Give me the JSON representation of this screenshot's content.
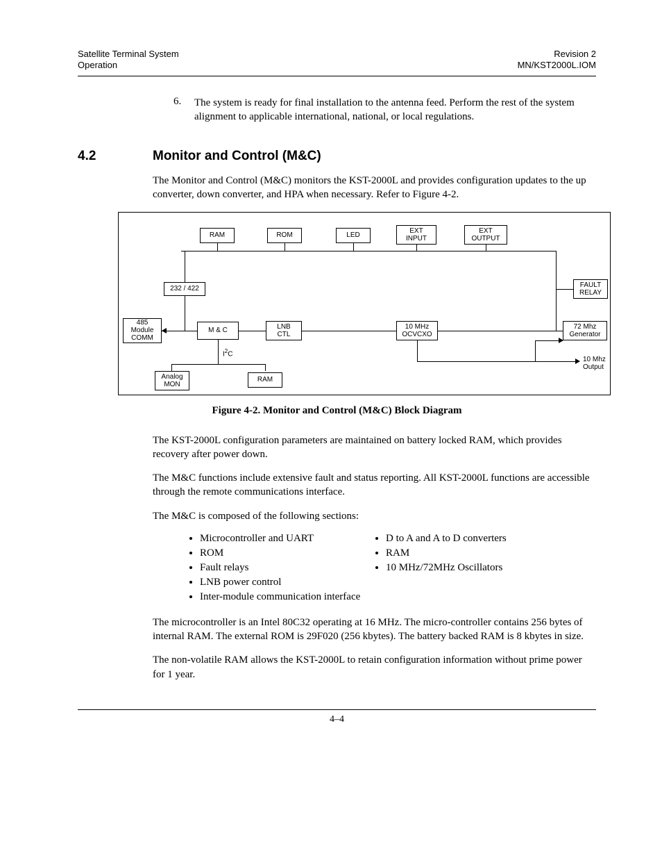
{
  "header": {
    "left1": "Satellite Terminal System",
    "left2": "Operation",
    "right1": "Revision 2",
    "right2": "MN/KST2000L.IOM"
  },
  "item6": {
    "num": "6.",
    "text": "The system is ready for final installation to the antenna feed. Perform the rest of the system alignment to applicable international, national, or local regulations."
  },
  "section": {
    "num": "4.2",
    "title": "Monitor and Control (M&C)"
  },
  "p1": "The Monitor and Control (M&C) monitors the KST-2000L and provides configuration updates to the up converter, down converter, and HPA when necessary. Refer to Figure 4-2.",
  "diagram": {
    "ram": "RAM",
    "rom": "ROM",
    "led": "LED",
    "ext_input": "EXT\nINPUT",
    "ext_output": "EXT\nOUTPUT",
    "rs232": "232 / 422",
    "fault_relay": "FAULT\nRELAY",
    "mod485": "485\nModule\nCOMM",
    "mc": "M & C",
    "lnb": "LNB\nCTL",
    "ocvcxo": "10 MHz\nOCVCXO",
    "gen72": "72 Mhz\nGenerator",
    "i2c": "I²C",
    "out10": "10 Mhz\nOutput",
    "analog": "Analog\nMON",
    "ram2": "RAM"
  },
  "figcap": "Figure 4-2.  Monitor and Control (M&C) Block Diagram",
  "p2": "The KST-2000L configuration parameters are maintained on battery locked RAM, which provides recovery after power down.",
  "p3": "The M&C functions include extensive fault and status reporting. All KST-2000L func­tions are accessible through the remote communications interface.",
  "p4": "The M&C is composed of the following sections:",
  "list_a": [
    "Microcontroller and UART",
    "ROM",
    "Fault relays",
    "LNB power control",
    "Inter-module communication interface"
  ],
  "list_b": [
    "D to A and A to D converters",
    "RAM",
    "10 MHz/72MHz Oscillators"
  ],
  "p5": "The microcontroller is an Intel 80C32 operating at 16 MHz. The micro-controller con­tains 256 bytes of internal RAM. The external ROM is 29F020 (256 kbytes). The battery backed RAM is 8 kbytes in size.",
  "p6": "The non-volatile RAM allows the KST-2000L to retain configuration information with­out prime power for 1 year.",
  "footer": "4–4"
}
